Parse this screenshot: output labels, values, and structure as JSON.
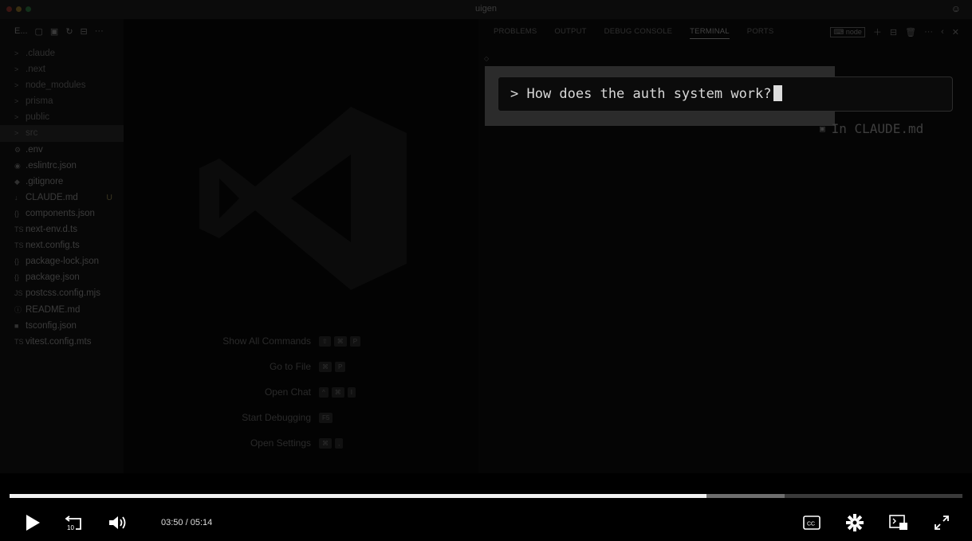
{
  "window": {
    "title": "uigen"
  },
  "explorer": {
    "header": "E...",
    "items": [
      {
        "label": ".claude",
        "type": "folder",
        "icon": ">"
      },
      {
        "label": ".next",
        "type": "folder",
        "icon": ">"
      },
      {
        "label": "node_modules",
        "type": "folder",
        "icon": ">"
      },
      {
        "label": "prisma",
        "type": "folder",
        "icon": ">"
      },
      {
        "label": "public",
        "type": "folder",
        "icon": ">"
      },
      {
        "label": "src",
        "type": "folder",
        "icon": ">"
      },
      {
        "label": ".env",
        "type": "file",
        "icon": "⚙"
      },
      {
        "label": ".eslintrc.json",
        "type": "file",
        "icon": "◉"
      },
      {
        "label": ".gitignore",
        "type": "file",
        "icon": "◆"
      },
      {
        "label": "CLAUDE.md",
        "type": "file",
        "icon": "↓",
        "badge": "U"
      },
      {
        "label": "components.json",
        "type": "file",
        "icon": "{}"
      },
      {
        "label": "next-env.d.ts",
        "type": "file",
        "icon": "TS"
      },
      {
        "label": "next.config.ts",
        "type": "file",
        "icon": "TS"
      },
      {
        "label": "package-lock.json",
        "type": "file",
        "icon": "{}"
      },
      {
        "label": "package.json",
        "type": "file",
        "icon": "{}"
      },
      {
        "label": "postcss.config.mjs",
        "type": "file",
        "icon": "JS"
      },
      {
        "label": "README.md",
        "type": "file",
        "icon": "ⓘ"
      },
      {
        "label": "tsconfig.json",
        "type": "file",
        "icon": "■"
      },
      {
        "label": "vitest.config.mts",
        "type": "file",
        "icon": "TS"
      }
    ]
  },
  "shortcuts": [
    {
      "label": "Show All Commands",
      "keys": [
        "⇧",
        "⌘",
        "P"
      ]
    },
    {
      "label": "Go to File",
      "keys": [
        "⌘",
        "P"
      ]
    },
    {
      "label": "Open Chat",
      "keys": [
        "^",
        "⌘",
        "I"
      ]
    },
    {
      "label": "Start Debugging",
      "keys": [
        "F5"
      ]
    },
    {
      "label": "Open Settings",
      "keys": [
        "⌘",
        ","
      ]
    }
  ],
  "panel": {
    "tabs": [
      "PROBLEMS",
      "OUTPUT",
      "DEBUG CONSOLE",
      "TERMINAL",
      "PORTS"
    ],
    "active_tab": "TERMINAL",
    "terminal_name": "node",
    "prompt_text": "> How does the auth system work?",
    "hint": "In CLAUDE.md"
  },
  "player": {
    "current_time": "03:50",
    "separator": "/",
    "duration": "05:14",
    "progress": 0.731,
    "buffered": 0.813
  }
}
